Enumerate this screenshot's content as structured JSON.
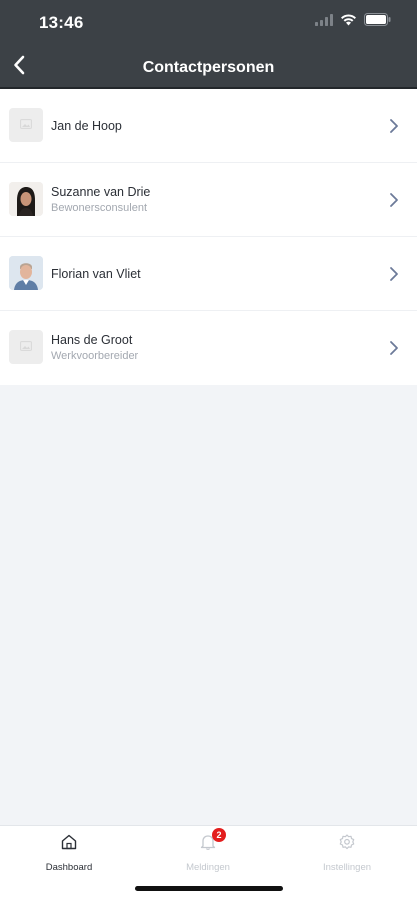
{
  "status_bar": {
    "time": "13:46"
  },
  "nav": {
    "title": "Contactpersonen"
  },
  "contacts": [
    {
      "name": "Jan de Hoop",
      "role": "",
      "avatar": "placeholder"
    },
    {
      "name": "Suzanne van Drie",
      "role": "Bewonersconsulent",
      "avatar": "photo-woman"
    },
    {
      "name": "Florian van Vliet",
      "role": "",
      "avatar": "photo-man"
    },
    {
      "name": "Hans de Groot",
      "role": "Werkvoorbereider",
      "avatar": "placeholder"
    }
  ],
  "tabbar": {
    "tabs": [
      {
        "label": "Dashboard",
        "icon": "home-icon",
        "active": true
      },
      {
        "label": "Meldingen",
        "icon": "bell-icon",
        "active": false,
        "badge": "2"
      },
      {
        "label": "Instellingen",
        "icon": "gear-icon",
        "active": false
      }
    ]
  },
  "colors": {
    "header": "#3c4146",
    "background": "#f2f4f7",
    "chevron": "#6c7a99",
    "badge": "#e31d1d",
    "active_tab": "#2b2f36",
    "inactive_tab": "#c4c8ce"
  }
}
